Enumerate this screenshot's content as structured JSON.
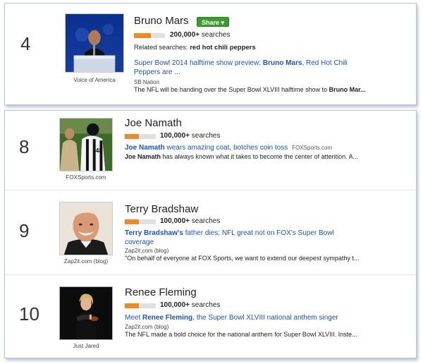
{
  "accent_colors": {
    "share_green": "#3b9c2e",
    "bar_orange": "#f08a24",
    "link_blue": "#1a52c9"
  },
  "featured": {
    "rank": "4",
    "name": "Bruno Mars",
    "share_label": "Share ▾",
    "searches_count": "200,000+",
    "searches_suffix": " searches",
    "bar_fraction": 0.55,
    "related_label": "Related searches: ",
    "related_term": "red hot chili peppers",
    "image_source": "Voice of America",
    "headline_pre": "Super Bowl 2014 halftime show preview: ",
    "headline_bold": "Bruno Mars",
    "headline_post": ", Red Hot Chili Peppers are ...",
    "headline_source": "SB Nation",
    "snippet_pre": "The NFL will be handing over the Super Bowl XLVIII halftime show to ",
    "snippet_bold": "Bruno Mar..."
  },
  "items": [
    {
      "rank": "8",
      "name": "Joe Namath",
      "searches_count": "100,000+",
      "searches_suffix": " searches",
      "bar_fraction": 0.45,
      "image_source": "FOXSports.com",
      "headline_bold": "Joe Namath",
      "headline_post": " wears amazing coat, botches coin toss",
      "headline_site": "FOXSports.com",
      "snippet_bold": "Joe Namath",
      "snippet_post": " has always known what it takes to become the center of attention. A..."
    },
    {
      "rank": "9",
      "name": "Terry Bradshaw",
      "searches_count": "100,000+",
      "searches_suffix": " searches",
      "bar_fraction": 0.45,
      "image_source": "Zap2it.com (blog)",
      "headline_bold": "Terry Bradshaw's",
      "headline_post": " father dies; NFL great not on FOX's Super Bowl coverage",
      "headline_source": "Zap2it.com (blog)",
      "snippet_post": "\"On behalf of everyone at FOX Sports, we want to extend our deepest sympathy t..."
    },
    {
      "rank": "10",
      "name": "Renee Fleming",
      "searches_count": "100,000+",
      "searches_suffix": " searches",
      "bar_fraction": 0.45,
      "image_source": "Just Jared",
      "headline_pre": "Meet ",
      "headline_bold": "Renee Fleming",
      "headline_post": ", the Super Bowl XLVIII national anthem singer",
      "headline_source": "Zap2it.com (blog)",
      "snippet_post": "The NFL made a bold choice for the national anthem for Super Bowl XLVIII. Inste..."
    }
  ]
}
